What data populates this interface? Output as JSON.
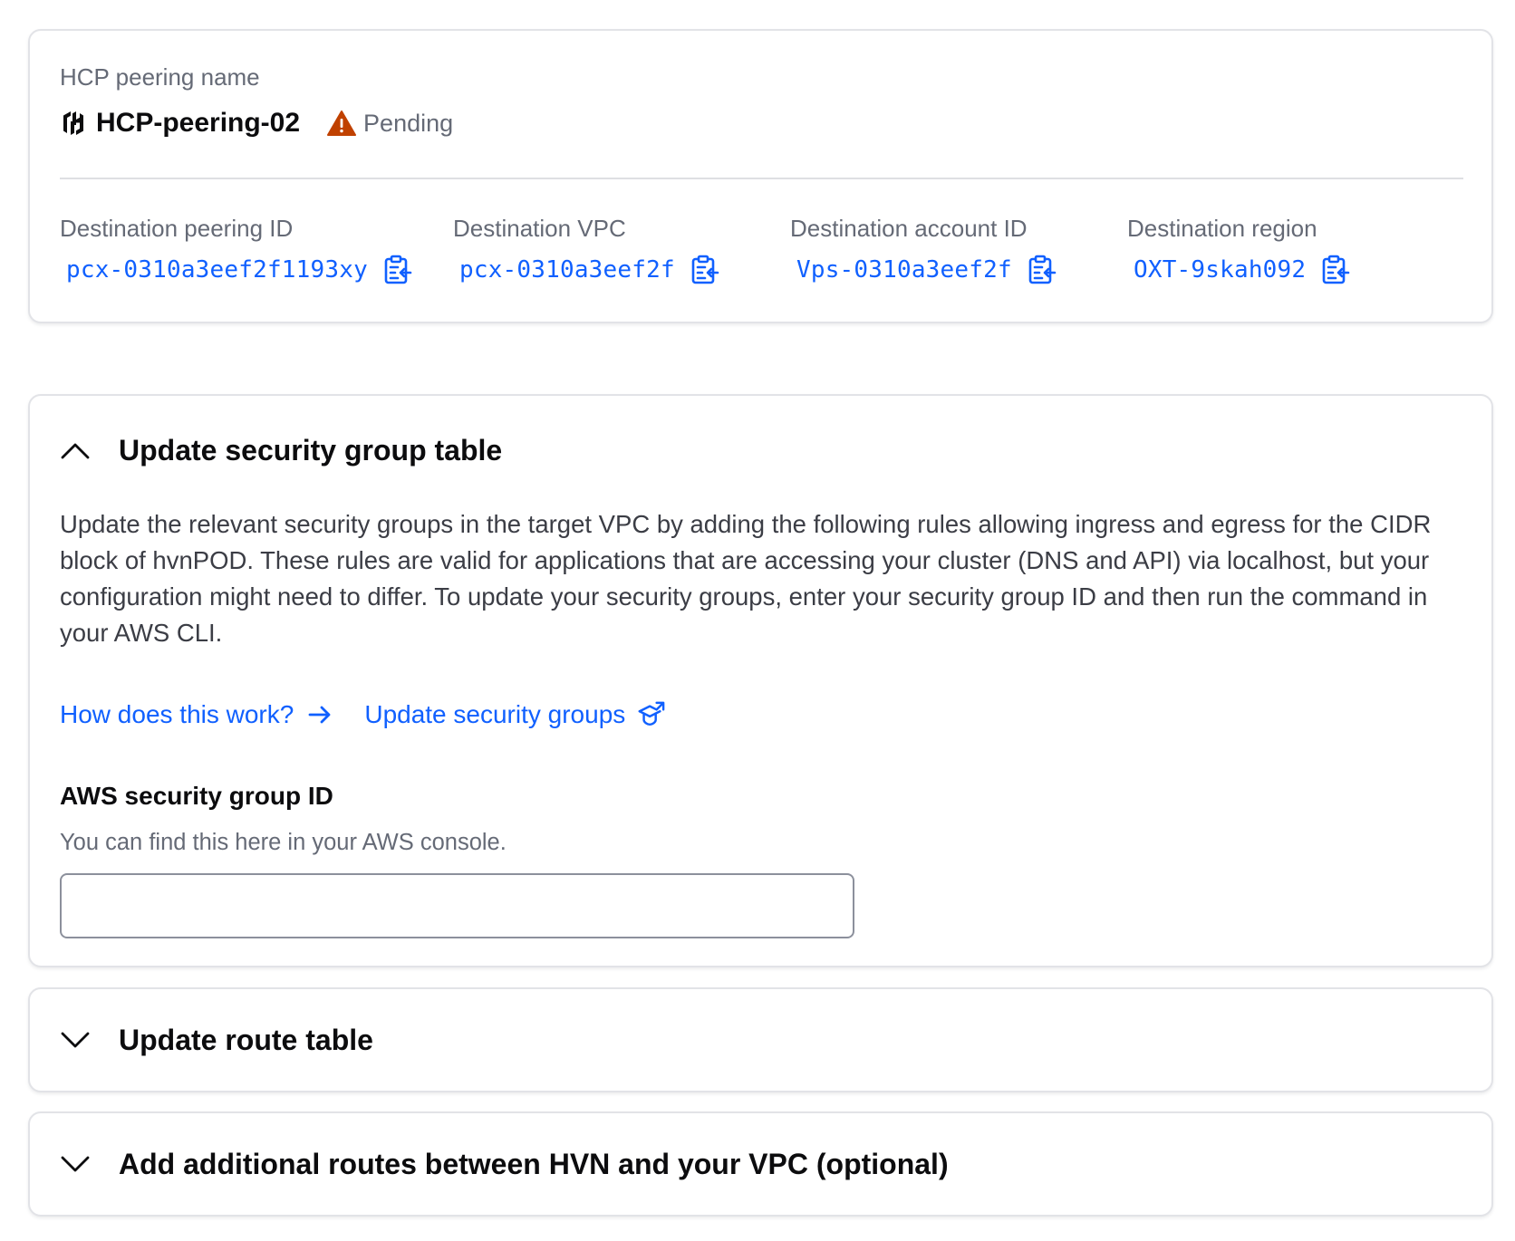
{
  "peering": {
    "label": "HCP peering name",
    "name": "HCP-peering-02",
    "logo_icon": "hcp-logo-icon",
    "status": {
      "text": "Pending",
      "icon": "warning-triangle-icon",
      "color": "#c04100"
    }
  },
  "details": [
    {
      "label": "Destination peering ID",
      "value": "pcx-0310a3eef2f1193xy",
      "icon": "clipboard-copy-icon"
    },
    {
      "label": "Destination VPC",
      "value": "pcx-0310a3eef2f",
      "icon": "clipboard-copy-icon"
    },
    {
      "label": "Destination account ID",
      "value": "Vps-0310a3eef2f",
      "icon": "clipboard-copy-icon"
    },
    {
      "label": "Destination region",
      "value": "OXT-9skah092",
      "icon": "clipboard-copy-icon"
    }
  ],
  "security_section": {
    "title": "Update security group table",
    "expanded": true,
    "chevron_icon": "chevron-up-icon",
    "description": "Update the relevant security groups in the target VPC by adding the following rules allowing ingress and egress for the CIDR block of hvnPOD. These rules are valid for applications that are accessing your cluster (DNS and API) via localhost, but your configuration might need to differ. To update your security groups, enter your security group ID and then run the command in your AWS CLI.",
    "links": [
      {
        "label": "How does this work?",
        "icon": "arrow-right-icon"
      },
      {
        "label": "Update security groups",
        "icon": "learn-external-icon"
      }
    ],
    "field": {
      "label": "AWS security group ID",
      "help": "You can find this here in your AWS console.",
      "value": "",
      "placeholder": ""
    }
  },
  "route_section": {
    "title": "Update route table",
    "expanded": false,
    "chevron_icon": "chevron-down-icon"
  },
  "additional_section": {
    "title": "Add additional routes between HVN and your VPC (optional)",
    "expanded": false,
    "chevron_icon": "chevron-down-icon"
  },
  "colors": {
    "link": "#1060ff",
    "heading": "#0c0c0e",
    "muted": "#656a76",
    "border": "#e2e3e7",
    "warning": "#c04100"
  }
}
